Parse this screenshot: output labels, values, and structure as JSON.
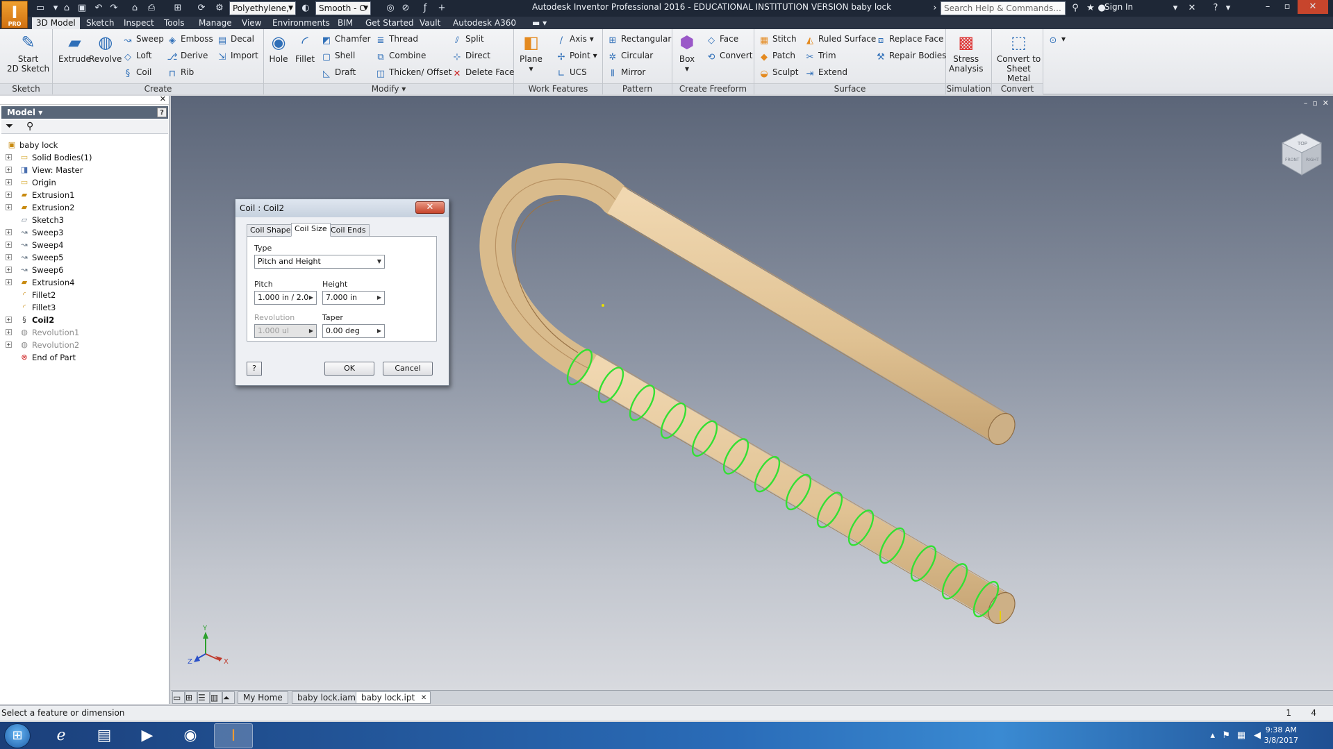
{
  "titlebar": {
    "app_logo": "I",
    "app_logo_sub": "PRO",
    "material": "Polyethylene,",
    "appearance": "Smooth - C",
    "title": "Autodesk Inventor Professional 2016 - EDUCATIONAL INSTITUTION VERSION     baby lock",
    "search_placeholder": "Search Help & Commands...",
    "sign_in": "Sign In"
  },
  "menu": {
    "tabs": [
      "3D Model",
      "Sketch",
      "Inspect",
      "Tools",
      "Manage",
      "View",
      "Environments",
      "BIM",
      "Get Started",
      "Vault",
      "Autodesk A360"
    ]
  },
  "ribbon": {
    "sketch": {
      "title": "Sketch",
      "start": "Start\n2D Sketch"
    },
    "create": {
      "title": "Create",
      "extrude": "Extrude",
      "revolve": "Revolve",
      "sweep": "Sweep",
      "loft": "Loft",
      "coil": "Coil",
      "emboss": "Emboss",
      "derive": "Derive",
      "rib": "Rib",
      "decal": "Decal",
      "import": "Import"
    },
    "modify": {
      "title": "Modify ▾",
      "hole": "Hole",
      "fillet": "Fillet",
      "chamfer": "Chamfer",
      "shell": "Shell",
      "draft": "Draft",
      "thread": "Thread",
      "combine": "Combine",
      "thicken": "Thicken/ Offset",
      "split": "Split",
      "direct": "Direct",
      "delete_face": "Delete Face"
    },
    "work_features": {
      "title": "Work Features",
      "plane": "Plane",
      "axis": "Axis",
      "point": "Point",
      "ucs": "UCS"
    },
    "pattern": {
      "title": "Pattern",
      "rectangular": "Rectangular",
      "circular": "Circular",
      "mirror": "Mirror"
    },
    "freeform": {
      "title": "Create Freeform",
      "box": "Box",
      "face": "Face",
      "convert": "Convert"
    },
    "surface": {
      "title": "Surface",
      "stitch": "Stitch",
      "patch": "Patch",
      "sculpt": "Sculpt",
      "ruled_surface": "Ruled Surface",
      "trim": "Trim",
      "extend": "Extend",
      "replace_face": "Replace Face",
      "repair_bodies": "Repair Bodies"
    },
    "simulation": {
      "title": "Simulation",
      "stress": "Stress\nAnalysis"
    },
    "convert": {
      "title": "Convert",
      "sheet_metal": "Convert to\nSheet Metal"
    }
  },
  "browser": {
    "header": "Model ▾",
    "tree": [
      {
        "label": "baby lock",
        "icon": "part-icon",
        "level": 0,
        "exp": false
      },
      {
        "label": "Solid Bodies(1)",
        "icon": "folder-icon",
        "level": 1,
        "exp": true
      },
      {
        "label": "View: Master",
        "icon": "view-icon",
        "level": 1,
        "exp": true
      },
      {
        "label": "Origin",
        "icon": "folder-icon",
        "level": 1,
        "exp": true
      },
      {
        "label": "Extrusion1",
        "icon": "extrude-icon",
        "level": 1,
        "exp": true
      },
      {
        "label": "Extrusion2",
        "icon": "extrude-icon",
        "level": 1,
        "exp": true
      },
      {
        "label": "Sketch3",
        "icon": "sketch-icon",
        "level": 1,
        "exp": false
      },
      {
        "label": "Sweep3",
        "icon": "sweep-icon",
        "level": 1,
        "exp": true
      },
      {
        "label": "Sweep4",
        "icon": "sweep-icon",
        "level": 1,
        "exp": true
      },
      {
        "label": "Sweep5",
        "icon": "sweep-icon",
        "level": 1,
        "exp": true
      },
      {
        "label": "Sweep6",
        "icon": "sweep-icon",
        "level": 1,
        "exp": true
      },
      {
        "label": "Extrusion4",
        "icon": "extrude-icon",
        "level": 1,
        "exp": true
      },
      {
        "label": "Fillet2",
        "icon": "fillet-icon",
        "level": 1,
        "exp": false
      },
      {
        "label": "Fillet3",
        "icon": "fillet-icon",
        "level": 1,
        "exp": false
      },
      {
        "label": "Coil2",
        "icon": "coil-icon",
        "level": 1,
        "exp": true,
        "bold": true
      },
      {
        "label": "Revolution1",
        "icon": "revolve-icon",
        "level": 1,
        "exp": true,
        "dim": true
      },
      {
        "label": "Revolution2",
        "icon": "revolve-icon",
        "level": 1,
        "exp": true,
        "dim": true
      },
      {
        "label": "End of Part",
        "icon": "end-of-part-icon",
        "level": 1,
        "exp": false
      }
    ]
  },
  "dialog": {
    "title": "Coil : Coil2",
    "tabs": [
      "Coil Shape",
      "Coil Size",
      "Coil Ends"
    ],
    "active_tab": "Coil Size",
    "type_label": "Type",
    "type_value": "Pitch and Height",
    "pitch_label": "Pitch",
    "pitch_value": "1.000 in / 2.0",
    "height_label": "Height",
    "height_value": "7.000 in",
    "revolution_label": "Revolution",
    "revolution_value": "1.000 ul",
    "taper_label": "Taper",
    "taper_value": "0.00 deg",
    "ok": "OK",
    "cancel": "Cancel"
  },
  "viewcube": {
    "top": "TOP",
    "front": "FRONT",
    "right": "RIGHT"
  },
  "triad": {
    "x": "X",
    "y": "Y",
    "z": "Z"
  },
  "doc_tabs": [
    "My Home",
    "baby lock.iam",
    "baby lock.ipt"
  ],
  "status": {
    "message": "Select a feature or dimension",
    "n1": "1",
    "n2": "4"
  },
  "taskbar": {
    "time": "9:38 AM",
    "date": "3/8/2017"
  },
  "colors": {
    "part": "#e3c69c",
    "coil": "#33e033",
    "title_bar": "#1e2736",
    "active_tab": "#e8eaee"
  }
}
